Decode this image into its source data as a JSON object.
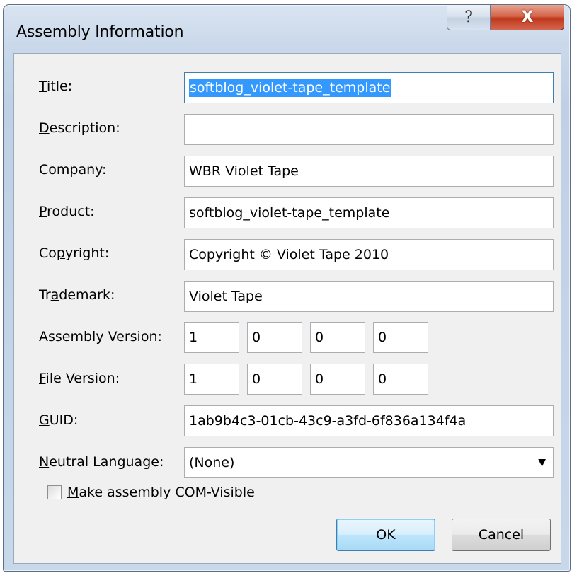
{
  "window": {
    "title": "Assembly Information",
    "help_glyph": "?",
    "close_glyph": "X"
  },
  "fields": {
    "title": {
      "label_pre": "",
      "label_ul": "T",
      "label_post": "itle:",
      "value": "softblog_violet-tape_template"
    },
    "description": {
      "label_pre": "",
      "label_ul": "D",
      "label_post": "escription:",
      "value": ""
    },
    "company": {
      "label_pre": "",
      "label_ul": "C",
      "label_post": "ompany:",
      "value": "WBR Violet Tape"
    },
    "product": {
      "label_pre": "",
      "label_ul": "P",
      "label_post": "roduct:",
      "value": "softblog_violet-tape_template"
    },
    "copyright": {
      "label_pre": "Co",
      "label_ul": "p",
      "label_post": "yright:",
      "value": "Copyright © Violet Tape 2010"
    },
    "trademark": {
      "label_pre": "Tr",
      "label_ul": "a",
      "label_post": "demark:",
      "value": "Violet Tape"
    },
    "assembly_version": {
      "label_pre": "",
      "label_ul": "A",
      "label_post": "ssembly Version:",
      "values": [
        "1",
        "0",
        "0",
        "0"
      ]
    },
    "file_version": {
      "label_pre": "",
      "label_ul": "F",
      "label_post": "ile Version:",
      "values": [
        "1",
        "0",
        "0",
        "0"
      ]
    },
    "guid": {
      "label_pre": "",
      "label_ul": "G",
      "label_post": "UID:",
      "value": "1ab9b4c3-01cb-43c9-a3fd-6f836a134f4a"
    },
    "neutral_language": {
      "label_pre": "",
      "label_ul": "N",
      "label_post": "eutral Language:",
      "value": "(None)",
      "arrow": "▼"
    }
  },
  "com_visible": {
    "label_pre": "",
    "label_ul": "M",
    "label_post": "ake assembly COM-Visible",
    "checked": false
  },
  "buttons": {
    "ok": "OK",
    "cancel": "Cancel"
  }
}
